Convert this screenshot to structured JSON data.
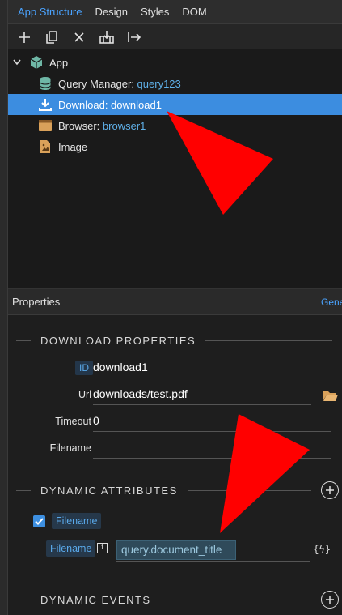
{
  "tabs": [
    {
      "label": "App Structure"
    },
    {
      "label": "Design"
    },
    {
      "label": "Styles"
    },
    {
      "label": "DOM"
    }
  ],
  "tree": {
    "root_label": "App",
    "items": [
      {
        "prefix": "Query Manager: ",
        "name": "query123"
      },
      {
        "prefix": "Download: ",
        "name": "download1"
      },
      {
        "prefix": "Browser: ",
        "name": "browser1"
      },
      {
        "prefix": "Image",
        "name": ""
      }
    ]
  },
  "properties": {
    "title": "Properties",
    "link_partial": "Gene",
    "section_download": "DOWNLOAD PROPERTIES",
    "id_label": "ID",
    "id_value": "download1",
    "url_label": "Url",
    "url_value": "downloads/test.pdf",
    "timeout_label": "Timeout",
    "timeout_value": "0",
    "filename_label": "Filename",
    "filename_value": "",
    "section_dynamic_attrs": "DYNAMIC ATTRIBUTES",
    "dyn_check_label": "Filename",
    "dyn_field_label": "Filename",
    "dyn_field_value": "query.document_title",
    "dyn_icon_text": "{ϟ}",
    "section_dynamic_events": "DYNAMIC EVENTS"
  },
  "colors": {
    "accent": "#4aa3ff",
    "selected_row": "#3c8de0",
    "annotation_arrow": "#ff0000"
  }
}
